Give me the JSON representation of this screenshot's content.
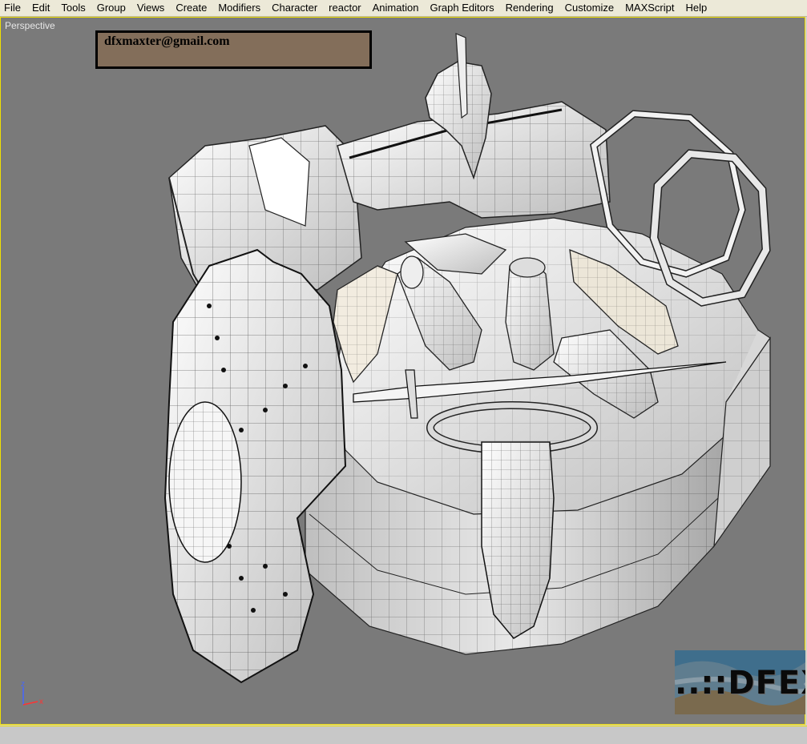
{
  "menubar": {
    "items": [
      "File",
      "Edit",
      "Tools",
      "Group",
      "Views",
      "Create",
      "Modifiers",
      "Character",
      "reactor",
      "Animation",
      "Graph Editors",
      "Rendering",
      "Customize",
      "MAXScript",
      "Help"
    ]
  },
  "viewport": {
    "label": "Perspective",
    "watermark_email": "dfxmaxter@gmail.com",
    "axis": {
      "z_label": "z",
      "x_label": "x"
    },
    "logo_text": "..::DFEX.:",
    "colors": {
      "background": "#7a7a7a",
      "active_border": "#f0e000",
      "email_box": "#836e5a"
    }
  }
}
